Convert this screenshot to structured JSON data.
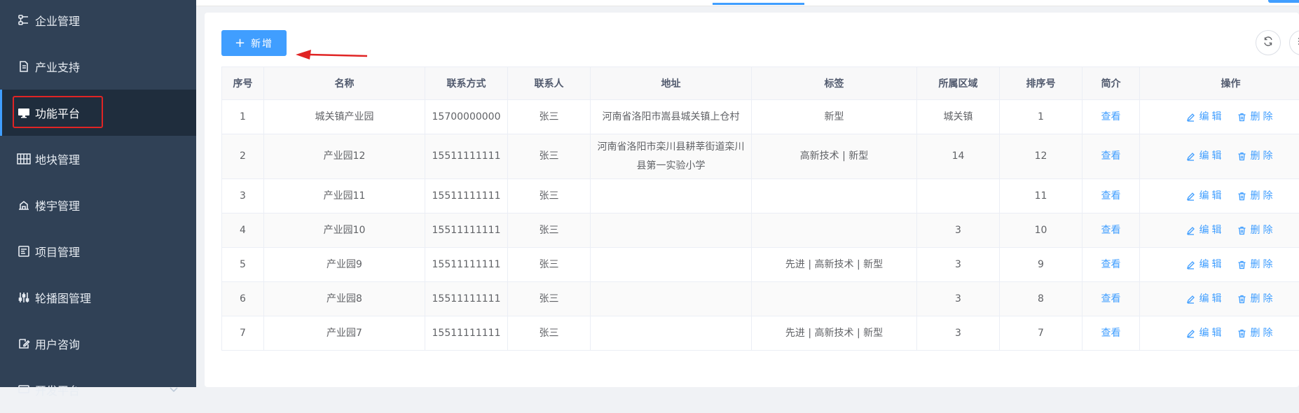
{
  "sidebar": {
    "items": [
      {
        "label": "企业管理",
        "icon": "branch-icon"
      },
      {
        "label": "产业支持",
        "icon": "document-icon"
      },
      {
        "label": "功能平台",
        "icon": "monitor-icon",
        "active": true
      },
      {
        "label": "地块管理",
        "icon": "grid-icon"
      },
      {
        "label": "楼宇管理",
        "icon": "building-icon"
      },
      {
        "label": "项目管理",
        "icon": "project-icon"
      },
      {
        "label": "轮播图管理",
        "icon": "sliders-icon"
      },
      {
        "label": "用户咨询",
        "icon": "edit-icon"
      },
      {
        "label": "开发平台",
        "icon": "platform-icon"
      }
    ]
  },
  "toolbar": {
    "add_label": "新增",
    "add_icon": "plus-icon",
    "refresh_icon": "refresh-icon",
    "columns_icon": "columns-icon"
  },
  "table": {
    "headers": [
      "序号",
      "名称",
      "联系方式",
      "联系人",
      "地址",
      "标签",
      "所属区域",
      "排序号",
      "简介",
      "操作"
    ],
    "rows": [
      {
        "no": "1",
        "name": "城关镇产业园",
        "phone": "15700000000",
        "contact": "张三",
        "address": "河南省洛阳市嵩县城关镇上仓村",
        "tags": "新型",
        "region": "城关镇",
        "sort": "1",
        "intro": "查看"
      },
      {
        "no": "2",
        "name": "产业园12",
        "phone": "15511111111",
        "contact": "张三",
        "address": "河南省洛阳市栾川县耕莘街道栾川县第一实验小学",
        "tags": "高新技术 | 新型",
        "region": "14",
        "sort": "12",
        "intro": "查看"
      },
      {
        "no": "3",
        "name": "产业园11",
        "phone": "15511111111",
        "contact": "张三",
        "address": "",
        "tags": "",
        "region": "",
        "sort": "11",
        "intro": "查看"
      },
      {
        "no": "4",
        "name": "产业园10",
        "phone": "15511111111",
        "contact": "张三",
        "address": "",
        "tags": "",
        "region": "3",
        "sort": "10",
        "intro": "查看"
      },
      {
        "no": "5",
        "name": "产业园9",
        "phone": "15511111111",
        "contact": "张三",
        "address": "",
        "tags": "先进 | 高新技术 | 新型",
        "region": "3",
        "sort": "9",
        "intro": "查看"
      },
      {
        "no": "6",
        "name": "产业园8",
        "phone": "15511111111",
        "contact": "张三",
        "address": "",
        "tags": "",
        "region": "3",
        "sort": "8",
        "intro": "查看"
      },
      {
        "no": "7",
        "name": "产业园7",
        "phone": "15511111111",
        "contact": "张三",
        "address": "",
        "tags": "先进 | 高新技术 | 新型",
        "region": "3",
        "sort": "7",
        "intro": "查看"
      }
    ],
    "edit_label": "编辑",
    "delete_label": "删除"
  },
  "colors": {
    "sidebar_bg": "#304156",
    "primary": "#409eff",
    "annotation": "#e02424"
  }
}
